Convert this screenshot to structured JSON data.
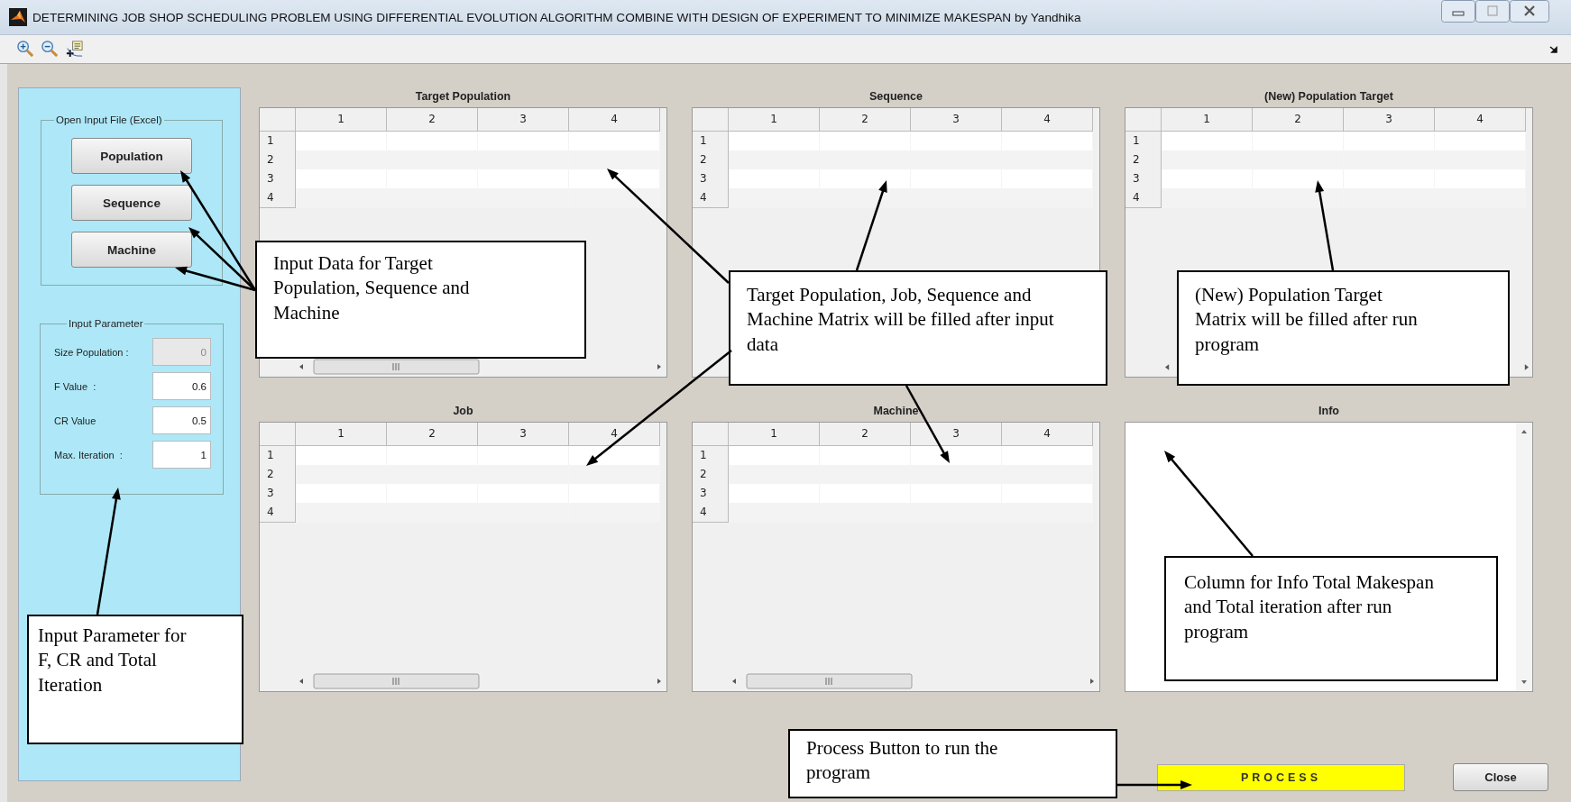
{
  "window": {
    "title": "DETERMINING JOB SHOP SCHEDULING PROBLEM USING DIFFERENTIAL EVOLUTION ALGORITHM COMBINE WITH DESIGN OF EXPERIMENT TO MINIMIZE MAKESPAN by Yandhika"
  },
  "input_file_panel": {
    "title": "Open Input File (Excel)",
    "buttons": [
      "Population",
      "Sequence",
      "Machine"
    ]
  },
  "parameter_panel": {
    "title": "Input Parameter",
    "fields": [
      {
        "label": "Size Population :",
        "value": "0",
        "disabled": true
      },
      {
        "label": "F Value  :",
        "value": "0.6",
        "disabled": false
      },
      {
        "label": "CR Value",
        "value": "0.5",
        "disabled": false
      },
      {
        "label": "Max. Iteration  :",
        "value": "1",
        "disabled": false
      }
    ]
  },
  "tables": [
    {
      "title": "Target Population",
      "columns": [
        "1",
        "2",
        "3",
        "4"
      ],
      "rows": [
        "1",
        "2",
        "3",
        "4"
      ]
    },
    {
      "title": "Sequence",
      "columns": [
        "1",
        "2",
        "3",
        "4"
      ],
      "rows": [
        "1",
        "2",
        "3",
        "4"
      ]
    },
    {
      "title": "(New) Population Target",
      "columns": [
        "1",
        "2",
        "3",
        "4"
      ],
      "rows": [
        "1",
        "2",
        "3",
        "4"
      ]
    },
    {
      "title": "Job",
      "columns": [
        "1",
        "2",
        "3",
        "4"
      ],
      "rows": [
        "1",
        "2",
        "3",
        "4"
      ]
    },
    {
      "title": "Machine",
      "columns": [
        "1",
        "2",
        "3",
        "4"
      ],
      "rows": [
        "1",
        "2",
        "3",
        "4"
      ]
    }
  ],
  "info": {
    "title": "Info"
  },
  "buttons": [
    {
      "label": "PROCESS",
      "kind": "primary"
    },
    {
      "label": "Close",
      "kind": "normal"
    }
  ],
  "annotations": [
    {
      "text": "Input Data for Target Population, Sequence and Machine"
    },
    {
      "text": "Target Population, Job, Sequence and Machine Matrix will be filled after input data"
    },
    {
      "text": "(New) Population Target Matrix will be filled after run program"
    },
    {
      "text": "Input Parameter for F, CR and Total Iteration"
    },
    {
      "text": "Column for Info Total Makespan and Total iteration after run program"
    },
    {
      "text": "Process Button to run the program"
    }
  ]
}
